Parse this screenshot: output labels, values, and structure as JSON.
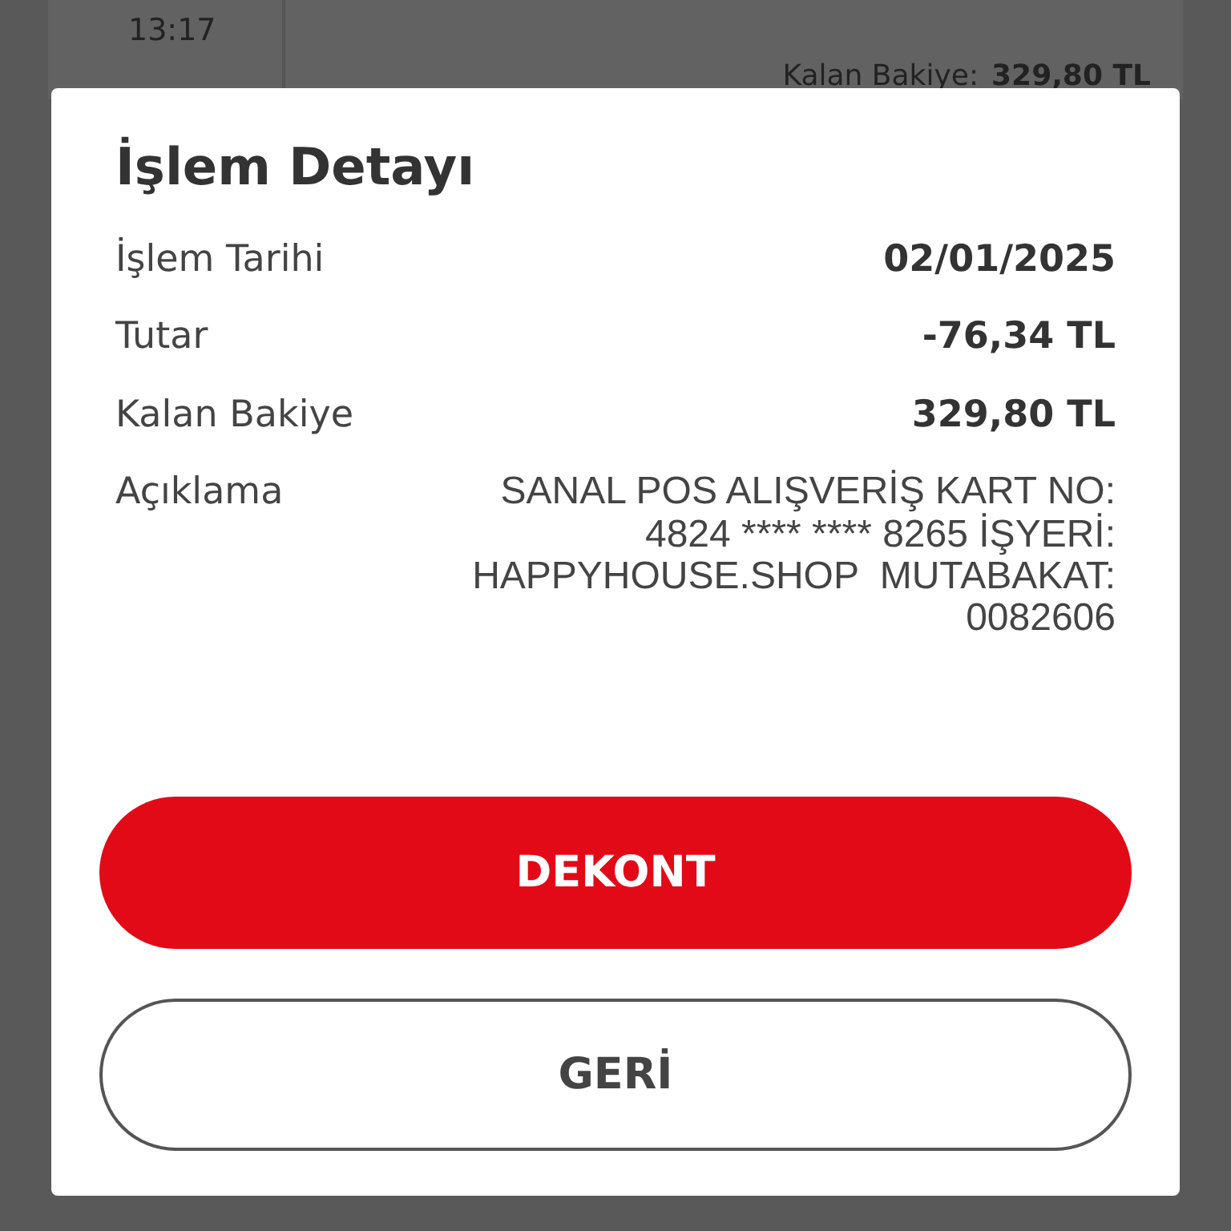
{
  "background_list": {
    "time": "13:17",
    "balance_label": "Kalan Bakiye:",
    "balance_value": "329,80 TL"
  },
  "dialog": {
    "title": "İşlem Detayı",
    "rows": [
      {
        "label": "İşlem Tarihi",
        "value": "02/01/2025",
        "kind": "strong"
      },
      {
        "label": "Tutar",
        "value": "-76,34 TL",
        "kind": "strong"
      },
      {
        "label": "Kalan Bakiye",
        "value": "329,80 TL",
        "kind": "strong"
      },
      {
        "label": "Açıklama",
        "value": "SANAL POS ALIŞVERİŞ KART NO: 4824 **** **** 8265 İŞYERİ: HAPPYHOUSE.SHOP  MUTABAKAT: 0082606",
        "kind": "plain"
      }
    ],
    "buttons": [
      {
        "label": "DEKONT",
        "kind": "primary"
      },
      {
        "label": "GERİ",
        "kind": "secondary"
      }
    ]
  }
}
